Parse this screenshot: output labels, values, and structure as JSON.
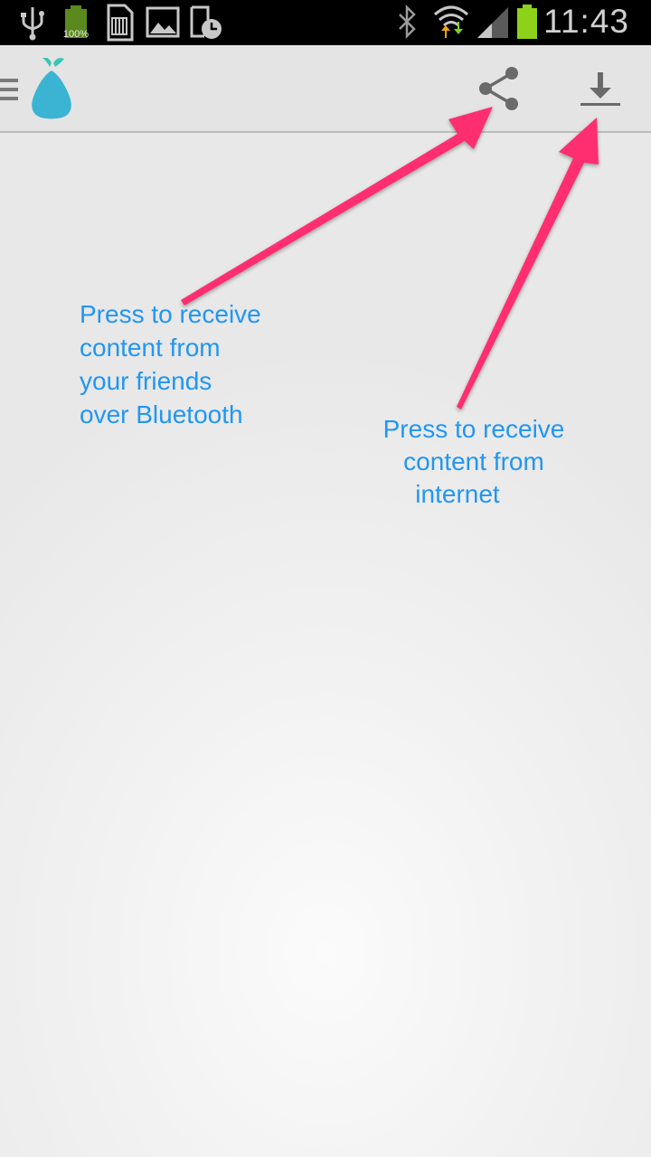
{
  "status_bar": {
    "battery_percent": "100%",
    "time": "11:43",
    "icons": [
      "usb-icon",
      "battery-icon",
      "sd-card-icon",
      "image-icon",
      "screen-timer-icon",
      "bluetooth-icon",
      "wifi-icon",
      "signal-icon",
      "battery-level-icon"
    ]
  },
  "action_bar": {
    "icons": [
      "menu-icon",
      "app-logo",
      "share-icon",
      "download-icon"
    ]
  },
  "hints": {
    "bluetooth": {
      "lines": [
        "Press to receive",
        "content from",
        "your friends",
        "over Bluetooth"
      ]
    },
    "internet": {
      "lines": [
        "Press to receive",
        "content from",
        "internet"
      ]
    }
  },
  "colors": {
    "accent_arrow": "#ff2d6f",
    "hint_text": "#2196f3",
    "logo": "#3bb4d4",
    "logo_leaf": "#39c6b5"
  }
}
